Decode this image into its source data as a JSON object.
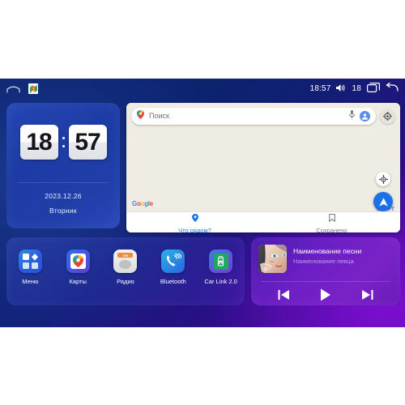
{
  "statusbar": {
    "home_icon": "home-icon",
    "app_icon": "google-maps-icon",
    "time": "18:57",
    "volume_icon": "volume-icon",
    "volume_level": "18",
    "recents_icon": "recents-icon",
    "back_icon": "back-icon"
  },
  "clock": {
    "hours": "18",
    "minutes": "57",
    "date": "2023.12.26",
    "weekday": "Вторник"
  },
  "maps": {
    "search": {
      "placeholder": "Поиск",
      "pin_icon": "map-pin-icon",
      "mic_icon": "microphone-icon",
      "avatar_icon": "account-avatar-icon",
      "settings_icon": "settings-gear-icon"
    },
    "watermark": "Google",
    "locate_icon": "locate-me-icon",
    "start_icon": "navigation-arrow-icon",
    "start_label": "СТАРТ",
    "tabs": [
      {
        "label": "Что рядом?",
        "icon": "map-pin-icon",
        "active": true
      },
      {
        "label": "Сохранено",
        "icon": "bookmark-icon",
        "active": false
      }
    ]
  },
  "dock": {
    "apps": [
      {
        "label": "Меню",
        "icon": "apps-grid-icon"
      },
      {
        "label": "Карты",
        "icon": "google-maps-icon"
      },
      {
        "label": "Радио",
        "icon": "radio-fm-icon",
        "band": "FM"
      },
      {
        "label": "Bluetooth",
        "icon": "bluetooth-phone-icon"
      },
      {
        "label": "Car Link 2.0",
        "icon": "car-link-icon"
      }
    ]
  },
  "music": {
    "album_art": "album-cover-portrait",
    "title": "Наименование песни",
    "artist": "Наименование певца",
    "controls": [
      {
        "name": "previous-track-button",
        "icon": "skip-previous-icon"
      },
      {
        "name": "play-button",
        "icon": "play-icon"
      },
      {
        "name": "next-track-button",
        "icon": "skip-next-icon"
      }
    ]
  },
  "colors": {
    "accent_blue": "#1a73e8",
    "bg_blue": "#0b1f73",
    "bg_purple": "#4d069e",
    "map_bg": "#efece4",
    "music_purple": "#6b1fc4"
  }
}
